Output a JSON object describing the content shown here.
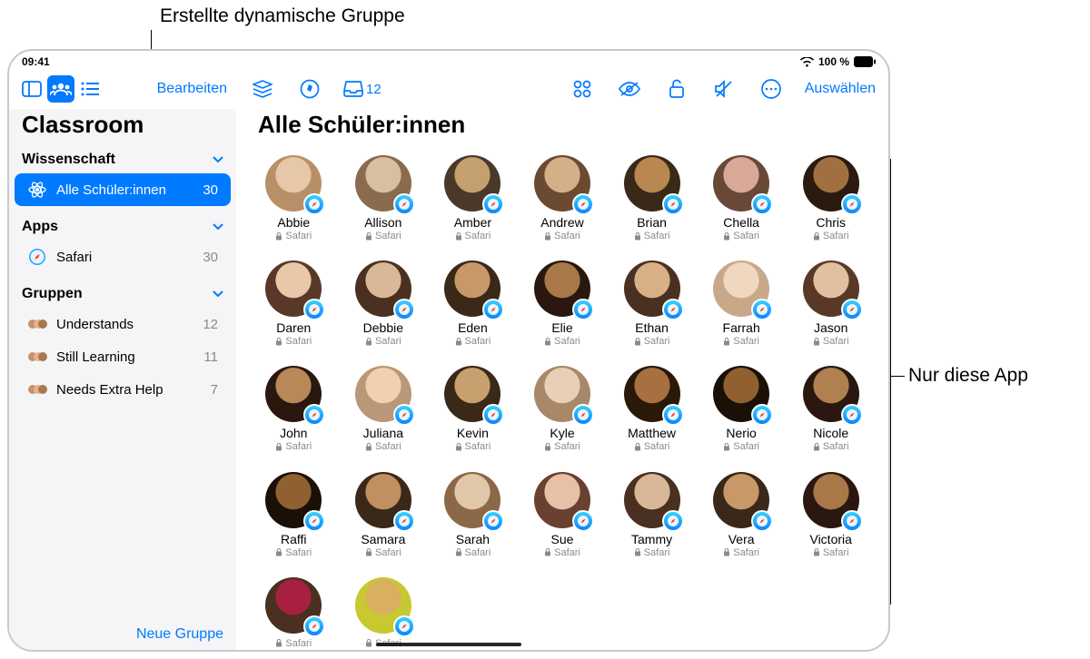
{
  "annotations": {
    "top": "Erstellte dynamische Gruppe",
    "right": "Nur diese App"
  },
  "statusbar": {
    "time": "09:41",
    "battery": "100 %"
  },
  "topbar": {
    "edit": "Bearbeiten",
    "inbox_count": "12",
    "select": "Auswählen"
  },
  "sidebar": {
    "app_title": "Classroom",
    "section_class": "Wissenschaft",
    "all_students": {
      "label": "Alle Schüler:innen",
      "count": "30"
    },
    "section_apps": "Apps",
    "apps": [
      {
        "label": "Safari",
        "count": "30"
      }
    ],
    "section_groups": "Gruppen",
    "groups": [
      {
        "label": "Understands",
        "count": "12"
      },
      {
        "label": "Still Learning",
        "count": "11"
      },
      {
        "label": "Needs Extra Help",
        "count": "7"
      }
    ],
    "new_group": "Neue Gruppe"
  },
  "main": {
    "title": "Alle Schüler:innen",
    "student_app": "Safari"
  },
  "students": [
    {
      "name": "Abbie",
      "c1": "#b89068",
      "c2": "#e6c8a8"
    },
    {
      "name": "Allison",
      "c1": "#8a6b4e",
      "c2": "#d8bfa0"
    },
    {
      "name": "Amber",
      "c1": "#4a3828",
      "c2": "#c4a070"
    },
    {
      "name": "Andrew",
      "c1": "#6b4a32",
      "c2": "#d4b088"
    },
    {
      "name": "Brian",
      "c1": "#3a2818",
      "c2": "#b88850"
    },
    {
      "name": "Chella",
      "c1": "#6a4838",
      "c2": "#d8a898"
    },
    {
      "name": "Chris",
      "c1": "#2a1a10",
      "c2": "#a07040"
    },
    {
      "name": "Daren",
      "c1": "#5a3828",
      "c2": "#e8c8a8"
    },
    {
      "name": "Debbie",
      "c1": "#4a3020",
      "c2": "#d8b898"
    },
    {
      "name": "Eden",
      "c1": "#3a2818",
      "c2": "#c89868"
    },
    {
      "name": "Elie",
      "c1": "#2a1810",
      "c2": "#a87848"
    },
    {
      "name": "Ethan",
      "c1": "#4a3020",
      "c2": "#d8b088"
    },
    {
      "name": "Farrah",
      "c1": "#c8a888",
      "c2": "#f0d8c0"
    },
    {
      "name": "Jason",
      "c1": "#5a3828",
      "c2": "#e0c0a0"
    },
    {
      "name": "John",
      "c1": "#2a1810",
      "c2": "#b88858"
    },
    {
      "name": "Juliana",
      "c1": "#b89878",
      "c2": "#f0d0b0"
    },
    {
      "name": "Kevin",
      "c1": "#3a2818",
      "c2": "#c8a070"
    },
    {
      "name": "Kyle",
      "c1": "#a88868",
      "c2": "#e8d0b8"
    },
    {
      "name": "Matthew",
      "c1": "#2a1808",
      "c2": "#a87040"
    },
    {
      "name": "Nerio",
      "c1": "#1a1008",
      "c2": "#906030"
    },
    {
      "name": "Nicole",
      "c1": "#2a1810",
      "c2": "#b08050"
    },
    {
      "name": "Raffi",
      "c1": "#1a1008",
      "c2": "#906030"
    },
    {
      "name": "Samara",
      "c1": "#3a2818",
      "c2": "#c09060"
    },
    {
      "name": "Sarah",
      "c1": "#8a6848",
      "c2": "#e0c8a8"
    },
    {
      "name": "Sue",
      "c1": "#6a4030",
      "c2": "#e8c0a8"
    },
    {
      "name": "Tammy",
      "c1": "#4a3020",
      "c2": "#d8b898"
    },
    {
      "name": "Vera",
      "c1": "#3a2818",
      "c2": "#c89868"
    },
    {
      "name": "Victoria",
      "c1": "#2a1810",
      "c2": "#a87848"
    },
    {
      "name": "",
      "c1": "#4a3020",
      "c2": "#a82040"
    },
    {
      "name": "",
      "c1": "#c8c830",
      "c2": "#d8b060"
    }
  ]
}
